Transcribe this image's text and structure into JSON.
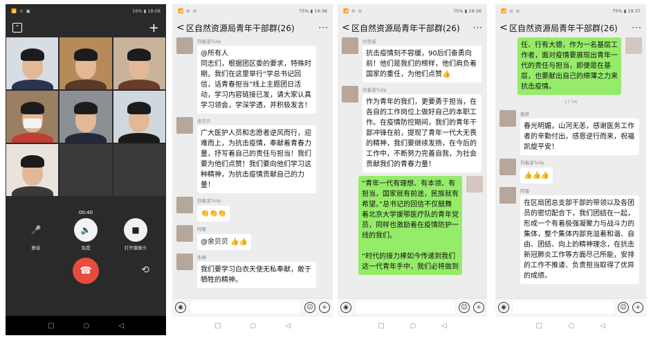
{
  "video_call": {
    "status": {
      "left": "📶 ⊙ ▣",
      "right": "16% ▮ 18:08"
    },
    "minimize_glyph": "⌃",
    "add_glyph": "+",
    "duration": "00:40",
    "mute_label": "静音",
    "speaker_label": "免提",
    "camera_label": "打开摄像头",
    "speaker_glyph": "🔈",
    "camera_glyph": "■",
    "mute_glyph": "🎤",
    "hangup_glyph": "☎",
    "switch_glyph": "⟲",
    "tiles": [
      {
        "bg": "#d8dde4",
        "shirt": "#2a3350"
      },
      {
        "bg": "#b78a5a",
        "shirt": "#5a3a26"
      },
      {
        "bg": "#c9b39b",
        "shirt": "#6a3a2a"
      },
      {
        "bg": "#9a7f62",
        "shirt": "#c23c32",
        "mask": true
      },
      {
        "bg": "#8c8f93",
        "shirt": "#24283a"
      },
      {
        "bg": "#cfd8de",
        "shirt": "#1a1a1a"
      },
      {
        "bg": "#e8e3dc",
        "shirt": "#3a3a3a"
      }
    ]
  },
  "chat_title": "区自然资源局青年干部群(26)",
  "screens": [
    {
      "status": {
        "left": "📶 ⊙ ⊙",
        "right": "75% ▮ 19:36"
      },
      "messages": [
        {
          "side": "left",
          "sender": "刘春凌Tulip",
          "text": "@所有人\n同志们，根据团区委的要求，特殊时期，我们在这里举行“学总书记回信，话青春担当”线上主题团日活动，学习内容链接已发，请大家认真学习领会，学深学透，并积极发言！"
        },
        {
          "side": "left",
          "sender": "余贝贝",
          "text": "广大医护人员和志愿者逆风而行，迎难而上，为抗击疫情，奉献着青春力量，抒写着自己的责任与担当！我们要为他们点赞！我们要向他们学习这种精神，为抗击疫情贡献自己的力量！"
        },
        {
          "side": "left",
          "sender": "刘春凌Tulip",
          "text": "👏👏👏"
        },
        {
          "side": "left",
          "sender": "阿蜀",
          "text": "@余贝贝 👍👍"
        },
        {
          "side": "left",
          "sender": "朱峰",
          "text": "我们要学习白衣天使无私奉献，敢于牺牲的精神。"
        }
      ]
    },
    {
      "status": {
        "left": "📶 ⊙ ⊙",
        "right": "75% ▮ 19:36"
      },
      "messages": [
        {
          "side": "left",
          "sender": "付哲威",
          "text": "抗击疫情刻不容缓，90后们奋勇向前！他们是我们的榜样，他们肩负着国家的重任，为他们点赞👍"
        },
        {
          "side": "left",
          "sender": "刘春凌Tulip",
          "text": "作为青年的我们，更要勇于担当，在各自的工作岗位上做好自己的本职工作。在疫情防控期间，我们的青年干部冲锋在前，提现了青年一代大无畏的精神，我们要继续发扬，在今后的工作中，不断努力完善自我，为社会贡献我们的青春力量！"
        },
        {
          "side": "right",
          "sender": "",
          "text": "“青年一代有理想、有本领、有担当，国家就有前途，民族就有希望。”总书记的回信不仅鼓舞着北京大学援鄂医疗队的青年党员，同样也激励着在疫情防护一线的我们。\n\n“时代的接力棒如今传递到我们这一代青年手中，我们必将做到"
        }
      ]
    },
    {
      "status": {
        "left": "📶 ⊙ ⊙",
        "right": "75% ▮ 19:37"
      },
      "messages": [
        {
          "side": "right",
          "sender": "",
          "text": "任、行有大德，作为一名基层工作者，面对疫情要展现出青年一代的责任与担当，即便是在基层，也要献出自己的绵薄之力来抗击疫情。"
        },
        {
          "side": "time",
          "sender": "",
          "text": "17:56"
        },
        {
          "side": "left",
          "sender": "晋妍",
          "text": "春光明媚，山河无恙，感谢医务工作者的辛勤付出，感恩逆行而来，祝福凯旋平安！"
        },
        {
          "side": "left",
          "sender": "刘春凌Tulip",
          "text": "👍👍👍"
        },
        {
          "side": "left",
          "sender": "阿蜀",
          "text": "在区局团总支部干部的带领以及各团员的密切配合下，我们团结在一起，形成一个有着极强凝聚力与战斗力的集体，整个集体内部充溢着和谐、自由、团结、向上的精神理念，在抗击新冠肺炎工作等方面尽己所能，安排的工作不推诿、负责担当取得了优异的成绩。"
        }
      ]
    }
  ],
  "input": {
    "voice_glyph": "◉",
    "emoji_glyph": "☺",
    "plus_glyph": "+"
  },
  "nav": {
    "back": "◁",
    "home": "○",
    "recent": "□"
  },
  "header": {
    "back_glyph": "<",
    "more_glyph": "···"
  }
}
